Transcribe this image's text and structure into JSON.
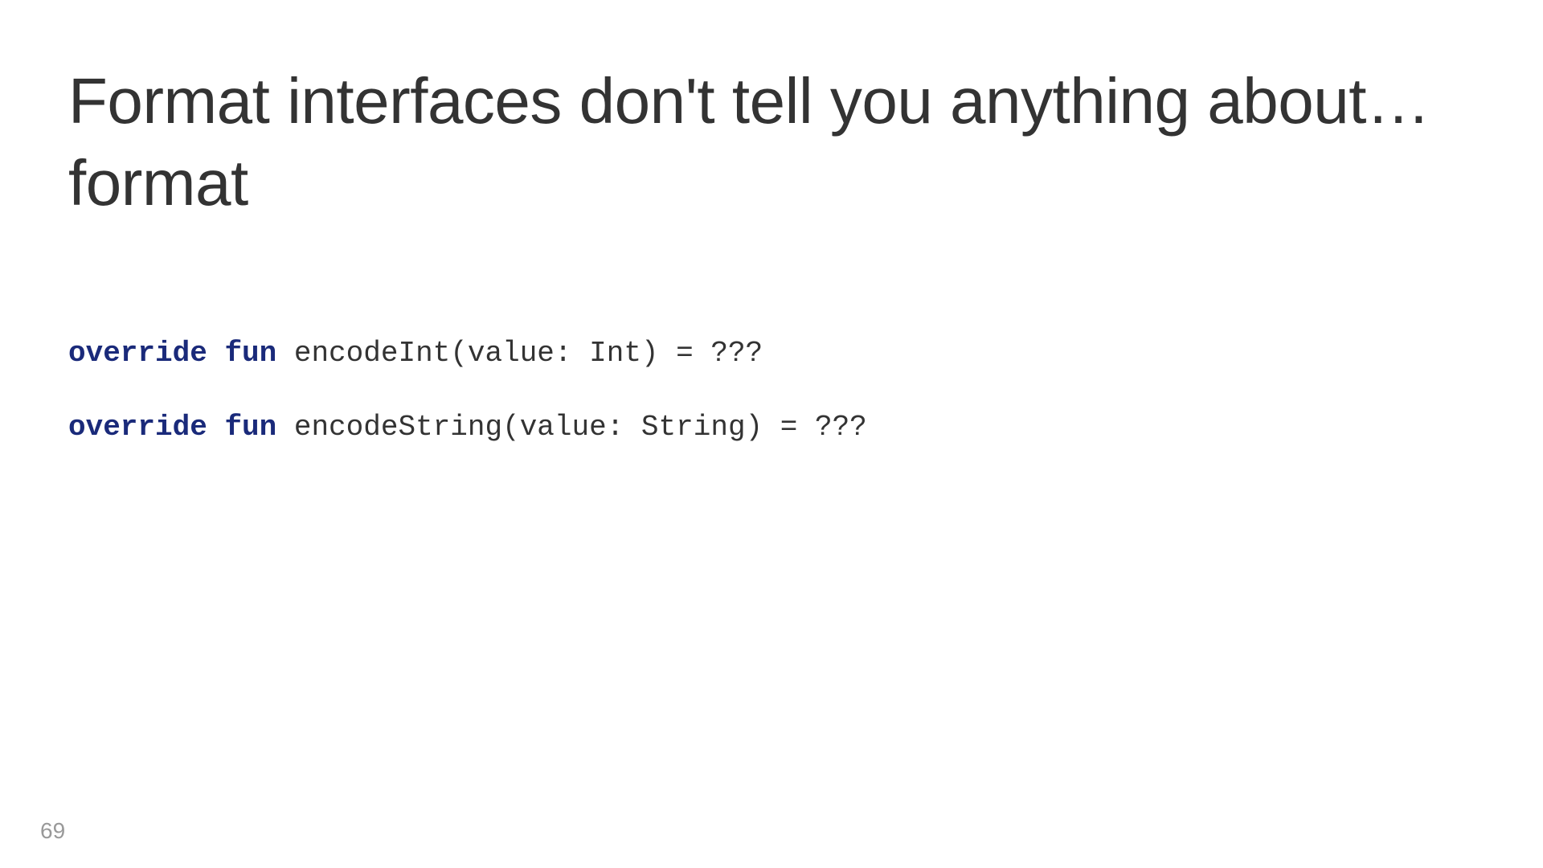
{
  "title": "Format interfaces don't tell you anything about… format",
  "code": {
    "line1": {
      "keyword1": "override",
      "keyword2": "fun",
      "rest": " encodeInt(value: Int) = ???"
    },
    "line2": {
      "keyword1": "override",
      "keyword2": "fun",
      "rest": " encodeString(value: String) = ???"
    }
  },
  "pageNumber": "69"
}
